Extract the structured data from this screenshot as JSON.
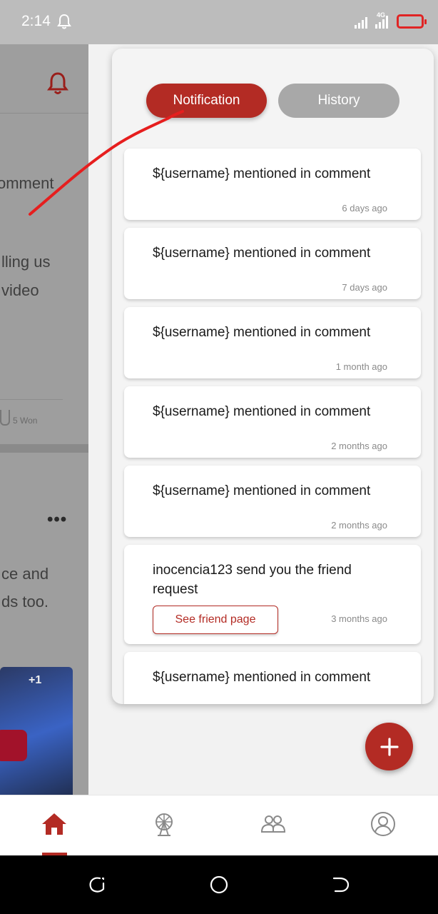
{
  "status_bar": {
    "time": "2:14",
    "network": "4G",
    "battery_color": "#e02424"
  },
  "background_page": {
    "texts": {
      "comment": "omment",
      "telling": "lling us",
      "video": "video",
      "won": "5 Won",
      "more": "•••",
      "take": "ce and",
      "friends": "ds too.",
      "badge": "+1"
    }
  },
  "panel": {
    "tabs": {
      "notification": "Notification",
      "history": "History"
    },
    "notifications": [
      {
        "title": "${username} mentioned in comment",
        "time": "6 days ago"
      },
      {
        "title": "${username} mentioned in comment",
        "time": "7 days ago"
      },
      {
        "title": "${username} mentioned in comment",
        "time": "1 month ago"
      },
      {
        "title": "${username} mentioned in comment",
        "time": "2 months ago"
      },
      {
        "title": "${username} mentioned in comment",
        "time": "2 months ago"
      },
      {
        "title": "inocencia123 send you the friend request",
        "time": "3 months ago",
        "action": "See friend page"
      },
      {
        "title": "${username} mentioned in comment",
        "time": ""
      }
    ]
  },
  "fab": {
    "icon": "plus-icon"
  },
  "bottom_nav": {
    "items": [
      {
        "icon": "home-icon",
        "active": true
      },
      {
        "icon": "ferris-wheel-icon",
        "active": false
      },
      {
        "icon": "people-icon",
        "active": false
      },
      {
        "icon": "profile-icon",
        "active": false
      }
    ]
  },
  "colors": {
    "accent": "#b32b24",
    "inactive_tab": "#a8a8a8",
    "annotation": "#e61e1e"
  }
}
